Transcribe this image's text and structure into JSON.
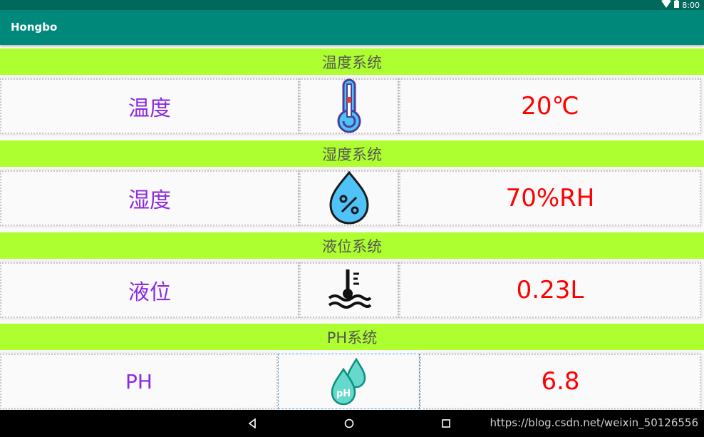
{
  "status_bar": {
    "time": "8:00",
    "wifi_icon": "wifi-icon",
    "battery_icon": "battery-icon"
  },
  "app_bar": {
    "title": "Hongbo"
  },
  "sections": [
    {
      "header": "温度系统",
      "label": "温度",
      "icon": "thermometer-icon",
      "value": "20℃"
    },
    {
      "header": "湿度系统",
      "label": "湿度",
      "icon": "humidity-drop-icon",
      "value": "70%RH"
    },
    {
      "header": "液位系统",
      "label": "液位",
      "icon": "water-level-icon",
      "value": "0.23L"
    },
    {
      "header": "PH系统",
      "label": "PH",
      "icon": "ph-drops-icon",
      "value": "6.8"
    }
  ],
  "nav_bar": {
    "back_icon": "back-icon",
    "home_icon": "home-icon",
    "recents_icon": "recents-icon"
  },
  "watermark": "https://blog.csdn.net/weixin_50126556",
  "colors": {
    "status_bar": "#00695c",
    "app_bar": "#00897b",
    "section_header": "#adff2f",
    "label_text": "#8a2be2",
    "value_text": "#ff0000"
  }
}
